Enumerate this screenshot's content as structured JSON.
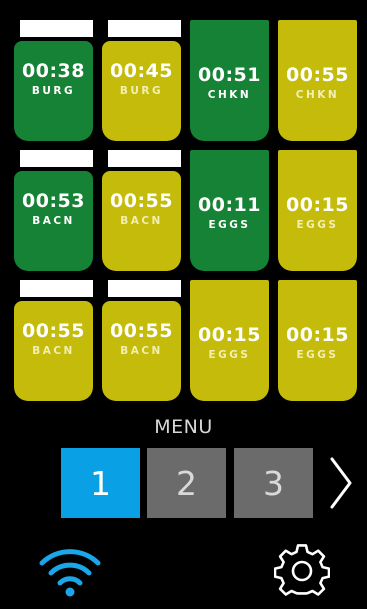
{
  "colors": {
    "tile_green": "#168235",
    "tile_olive": "#c4bb0b",
    "menu_active": "#0aa0e6",
    "menu_inactive": "#6b6b6b",
    "wifi": "#1aa6e8",
    "background": "#000000"
  },
  "tiles": [
    {
      "time": "00:38",
      "label": "BURG",
      "color": "green",
      "indicator": true
    },
    {
      "time": "00:45",
      "label": "BURG",
      "color": "olive",
      "indicator": true
    },
    {
      "time": "00:51",
      "label": "CHKN",
      "color": "green",
      "indicator": false
    },
    {
      "time": "00:55",
      "label": "CHKN",
      "color": "olive",
      "indicator": false
    },
    {
      "time": "00:53",
      "label": "BACN",
      "color": "green",
      "indicator": true
    },
    {
      "time": "00:55",
      "label": "BACN",
      "color": "olive",
      "indicator": true
    },
    {
      "time": "00:11",
      "label": "EGGS",
      "color": "green",
      "indicator": false
    },
    {
      "time": "00:15",
      "label": "EGGS",
      "color": "olive",
      "indicator": false
    },
    {
      "time": "00:55",
      "label": "BACN",
      "color": "olive",
      "indicator": true
    },
    {
      "time": "00:55",
      "label": "BACN",
      "color": "olive",
      "indicator": true
    },
    {
      "time": "00:15",
      "label": "EGGS",
      "color": "olive",
      "indicator": false
    },
    {
      "time": "00:15",
      "label": "EGGS",
      "color": "olive",
      "indicator": false
    }
  ],
  "menu": {
    "title": "MENU",
    "pages": [
      "1",
      "2",
      "3"
    ],
    "active_page": "1",
    "next_icon": "chevron-right-icon"
  },
  "status": {
    "wifi_icon": "wifi-icon",
    "settings_icon": "gear-icon"
  }
}
